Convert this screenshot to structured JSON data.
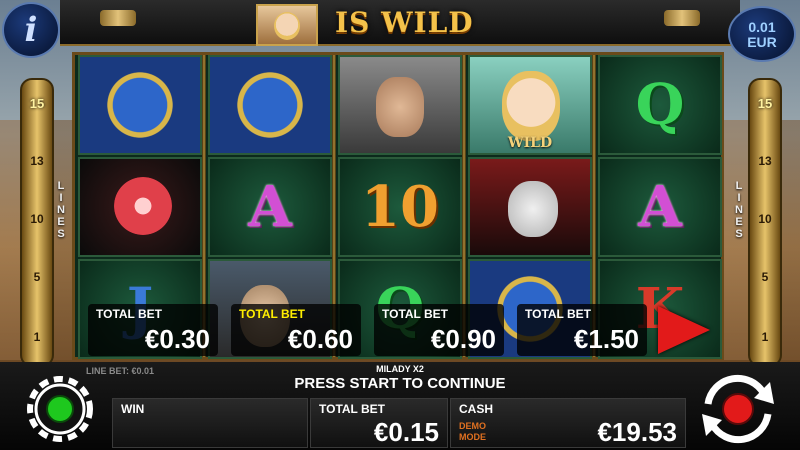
{
  "header": {
    "title": "IS WILD",
    "info_label": "i",
    "denomination_value": "0.01",
    "denomination_currency": "EUR"
  },
  "lines": {
    "word": "LINES",
    "numbers": [
      "15",
      "13",
      "10",
      "5",
      "1"
    ]
  },
  "reels": {
    "wild_label": "WILD",
    "symbols": [
      [
        "horse",
        "rose",
        "J"
      ],
      [
        "horse",
        "A",
        "princess"
      ],
      [
        "knight",
        "10",
        "Q"
      ],
      [
        "lady-wild",
        "jester",
        "horse"
      ],
      [
        "Q",
        "A",
        "K"
      ]
    ]
  },
  "bet_options": [
    {
      "label": "TOTAL BET",
      "value": "€0.30",
      "selected": false
    },
    {
      "label": "TOTAL BET",
      "value": "€0.60",
      "selected": true
    },
    {
      "label": "TOTAL BET",
      "value": "€0.90",
      "selected": false
    },
    {
      "label": "TOTAL BET",
      "value": "€1.50",
      "selected": false
    }
  ],
  "status": {
    "line_bet": "LINE BET: €0.01",
    "feature_name": "MILADY X2",
    "message": "PRESS START TO CONTINUE"
  },
  "panels": {
    "win_label": "WIN",
    "win_value": "",
    "total_bet_label": "TOTAL BET",
    "total_bet_value": "€0.15",
    "cash_label": "CASH",
    "cash_value": "€19.53",
    "demo_line1": "DEMO",
    "demo_line2": "MODE"
  },
  "colors": {
    "selected_bet": "#ffee00",
    "play_arrow": "#e21a1a",
    "settings_indicator": "#1ec81e",
    "spin_indicator": "#e21a1a",
    "demo_mode": "#e07020"
  },
  "icons": {
    "settings": "gear-icon",
    "spin": "refresh-arrows-icon",
    "play": "play-arrow-icon",
    "info": "info-icon"
  }
}
